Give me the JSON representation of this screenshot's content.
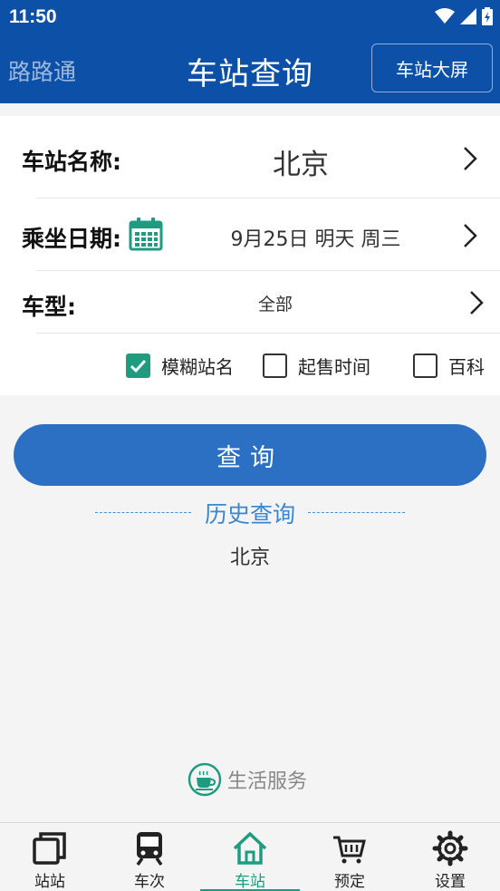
{
  "status_bar": {
    "time": "11:50"
  },
  "header": {
    "app_name": "路路通",
    "title": "车站查询",
    "screen_button": "车站大屏"
  },
  "form": {
    "station": {
      "label": "车站名称:",
      "value": "北京"
    },
    "date": {
      "label": "乘坐日期:",
      "value": "9月25日 明天 周三"
    },
    "train_type": {
      "label": "车型:",
      "value": "全部"
    },
    "options": [
      {
        "label": "模糊站名",
        "checked": true
      },
      {
        "label": "起售时间",
        "checked": false
      },
      {
        "label": "百科",
        "checked": false
      }
    ]
  },
  "query_button": "查询",
  "history": {
    "title": "历史查询",
    "items": [
      "北京"
    ]
  },
  "life_service": "生活服务",
  "tabs": [
    {
      "label": "站站",
      "icon": "station-to-station-icon",
      "active": false
    },
    {
      "label": "车次",
      "icon": "train-icon",
      "active": false
    },
    {
      "label": "车站",
      "icon": "home-station-icon",
      "active": true
    },
    {
      "label": "预定",
      "icon": "cart-icon",
      "active": false
    },
    {
      "label": "设置",
      "icon": "gear-icon",
      "active": false
    }
  ],
  "colors": {
    "primary": "#0d50a8",
    "button": "#2c70c4",
    "accent": "#1f9b80",
    "history": "#3b86d0"
  }
}
